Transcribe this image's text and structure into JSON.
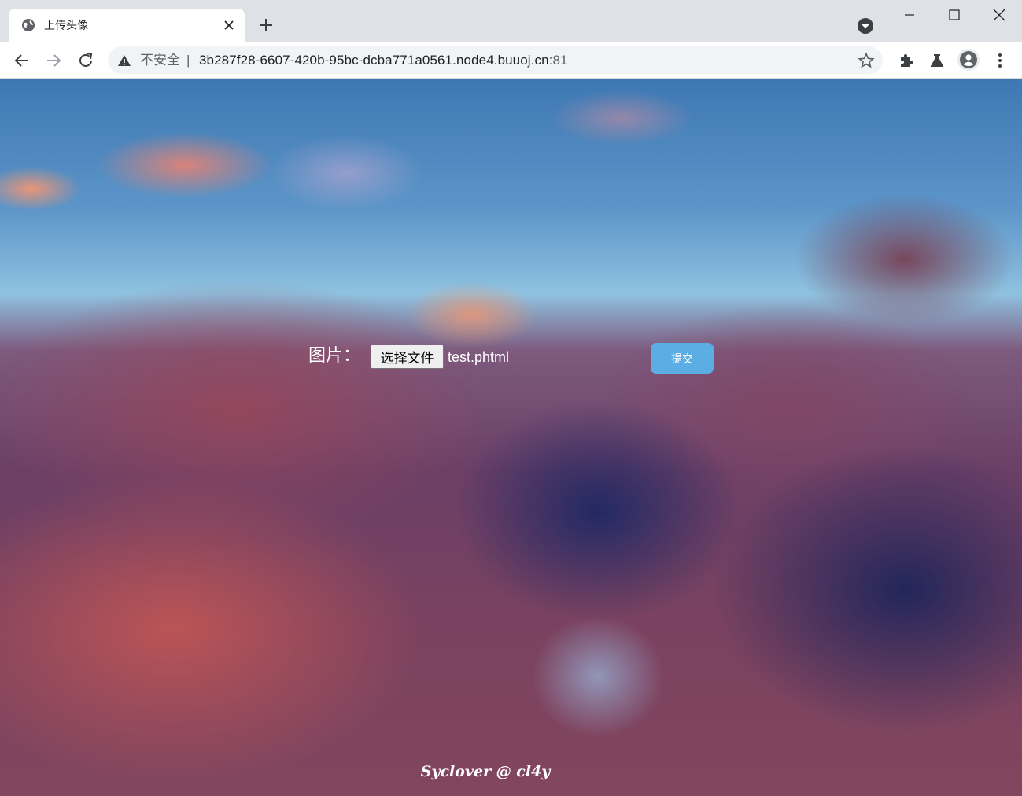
{
  "browser": {
    "tab": {
      "title": "上传头像"
    },
    "address_bar": {
      "security_label": "不安全",
      "separator": "|",
      "url_host": "3b287f28-6607-420b-95bc-dcba771a0561.node4.buuoj.cn",
      "url_port": ":81"
    },
    "icons": {
      "favicon": "globe-icon",
      "tab_close": "close-icon",
      "new_tab": "plus-icon",
      "tab_search": "tab-search-icon",
      "minimize": "minimize-icon",
      "maximize": "maximize-icon",
      "close_window": "close-icon",
      "back": "arrow-left-icon",
      "forward": "arrow-right-icon",
      "reload": "reload-icon",
      "security": "warning-icon",
      "bookmark": "star-icon",
      "extensions": "puzzle-icon",
      "labs": "flask-icon",
      "profile": "person-icon",
      "menu": "kebab-menu-icon"
    }
  },
  "page": {
    "form": {
      "image_label": "图片：",
      "file_button_label": "选择文件",
      "selected_file": "test.phtml",
      "submit_label": "提交"
    },
    "footer": {
      "credit": "Syclover @ cl4y"
    },
    "colors": {
      "submit_button": "#5aaee3",
      "text": "#ffffff"
    }
  }
}
